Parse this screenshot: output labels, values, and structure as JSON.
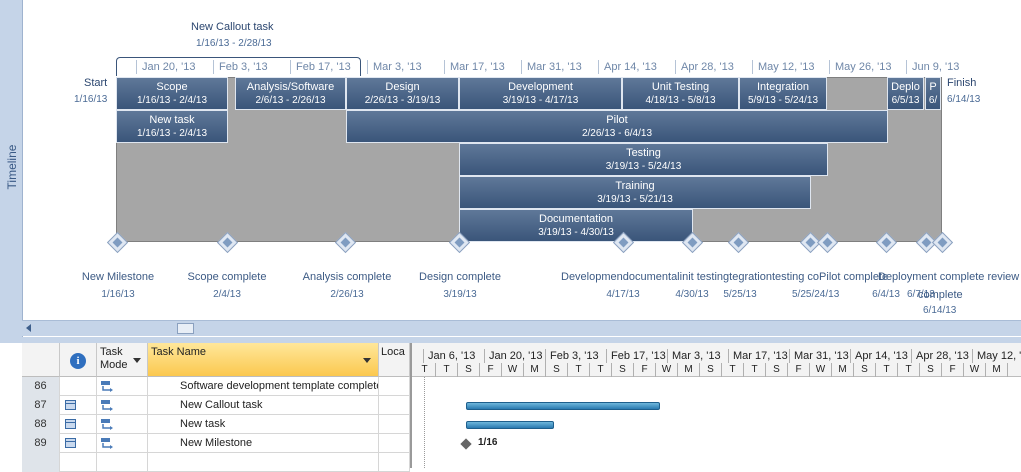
{
  "timeline": {
    "side_label": "Timeline",
    "callout": {
      "name": "New Callout task",
      "dates": "1/16/13 - 2/28/13"
    },
    "start": {
      "label": "Start",
      "date": "1/16/13"
    },
    "finish": {
      "label": "Finish",
      "date": "6/14/13"
    },
    "scale": [
      "Jan 20, '13",
      "Feb 3, '13",
      "Feb 17, '13",
      "Mar 3, '13",
      "Mar 17, '13",
      "Mar 31, '13",
      "Apr 14, '13",
      "Apr 28, '13",
      "May 12, '13",
      "May 26, '13",
      "Jun 9, '13"
    ],
    "bars": [
      {
        "name": "Scope",
        "dates": "1/16/13 - 2/4/13"
      },
      {
        "name": "Analysis/Software",
        "dates": "2/6/13 - 2/26/13"
      },
      {
        "name": "Design",
        "dates": "2/26/13 - 3/19/13"
      },
      {
        "name": "Development",
        "dates": "3/19/13 - 4/17/13"
      },
      {
        "name": "Unit Testing",
        "dates": "4/18/13 - 5/8/13"
      },
      {
        "name": "Integration",
        "dates": "5/9/13 - 5/24/13"
      },
      {
        "name": "Deplo",
        "dates": "6/5/13"
      },
      {
        "name": "P",
        "dates": "6/"
      },
      {
        "name": "New task",
        "dates": "1/16/13 - 2/4/13"
      },
      {
        "name": "Pilot",
        "dates": "2/26/13 - 6/4/13"
      },
      {
        "name": "Testing",
        "dates": "3/19/13 - 5/24/13"
      },
      {
        "name": "Training",
        "dates": "3/19/13 - 5/21/13"
      },
      {
        "name": "Documentation",
        "dates": "3/19/13 - 4/30/13"
      }
    ],
    "milestones": [
      {
        "name": "New Milestone",
        "date": "1/16/13"
      },
      {
        "name": "Scope complete",
        "date": "2/4/13"
      },
      {
        "name": "Analysis complete",
        "date": "2/26/13"
      },
      {
        "name": "Design complete",
        "date": "3/19/13"
      },
      {
        "name": "Development complete",
        "date": "4/17/13"
      },
      {
        "name": "Documentation complete",
        "date": "4/30/13"
      },
      {
        "name": "Unit testing complete",
        "date": "5/8/13"
      },
      {
        "name": "Integration testing complete",
        "date": "5/25/13"
      },
      {
        "name": "Training materials complete",
        "date": "5/24/13"
      },
      {
        "name": "Pilot complete",
        "date": "6/4/13"
      },
      {
        "name": "Deployment complete",
        "date": "6/7/13"
      },
      {
        "name": "Post implementation review complete",
        "date": "6/14/13"
      }
    ],
    "overlap_text": {
      "row1": "Developmendocumentalinit testingtegrationtesting coPilot complete",
      "row1b": "Deployment complete review",
      "row2a": "5/25/24/13",
      "row2b": "6/7/13",
      "row3": "complete",
      "row4": "6/14/13"
    }
  },
  "grid": {
    "headers": {
      "info": "i",
      "mode": "Task\nMode",
      "name": "Task Name",
      "loc": "Loca"
    },
    "rows": [
      {
        "id": "86",
        "name": "Software development template complete",
        "indicator": false
      },
      {
        "id": "87",
        "name": "New Callout task",
        "indicator": true
      },
      {
        "id": "88",
        "name": "New task",
        "indicator": true
      },
      {
        "id": "89",
        "name": "New Milestone",
        "indicator": true
      }
    ]
  },
  "gantt": {
    "weeks": [
      "Jan 6, '13",
      "Jan 20, '13",
      "Feb 3, '13",
      "Feb 17, '13",
      "Mar 3, '13",
      "Mar 17, '13",
      "Mar 31, '13",
      "Apr 14, '13",
      "Apr 28, '13",
      "May 12, '13"
    ],
    "days": [
      "T",
      "T",
      "S",
      "F",
      "W",
      "M",
      "S",
      "T",
      "T",
      "S",
      "F",
      "W",
      "M",
      "S",
      "T",
      "T",
      "S",
      "F",
      "W",
      "M",
      "S",
      "T",
      "T",
      "S",
      "F",
      "W",
      "M"
    ],
    "milestone_label": "1/16"
  },
  "colors": {
    "timeline_bar": "#3f5a80",
    "gantt_bar": "#3a8fc4",
    "highlight_header": "#ffd966"
  }
}
